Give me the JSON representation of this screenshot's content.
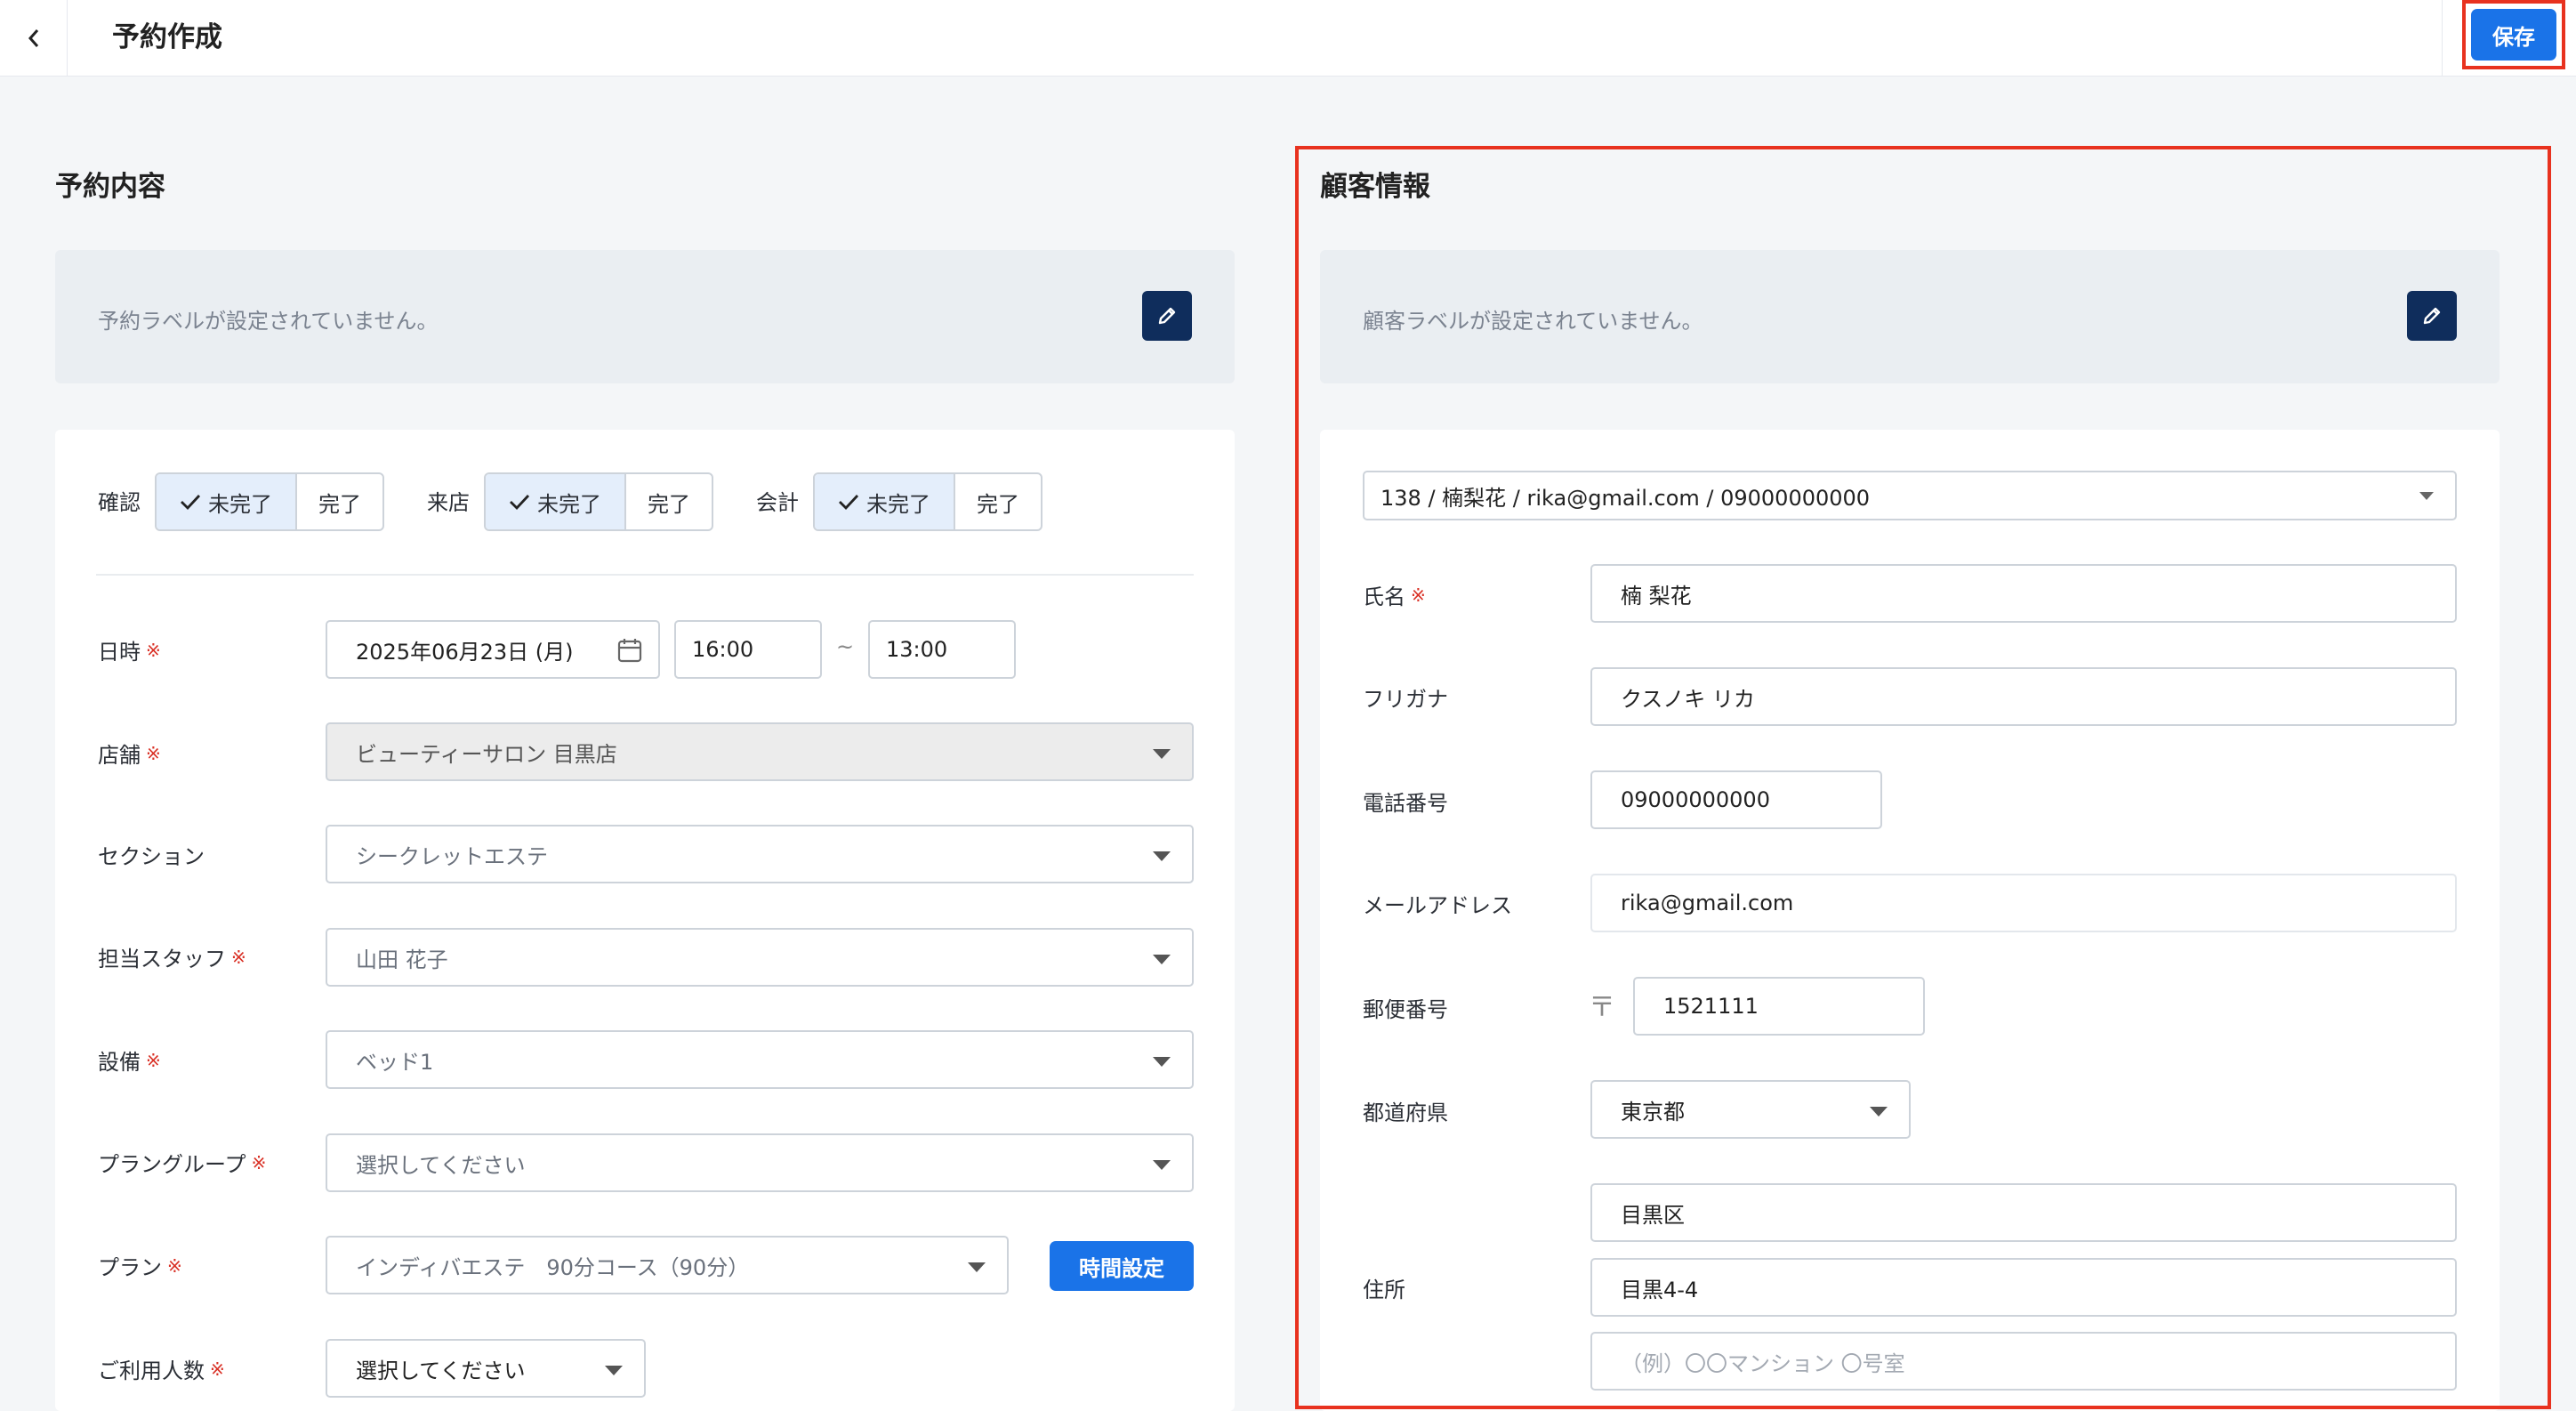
{
  "header": {
    "title": "予約作成",
    "save_label": "保存"
  },
  "reservation": {
    "section_title": "予約内容",
    "label_placeholder": "予約ラベルが設定されていません。",
    "status_groups": [
      {
        "label": "確認",
        "incomplete": "未完了",
        "complete": "完了"
      },
      {
        "label": "来店",
        "incomplete": "未完了",
        "complete": "完了"
      },
      {
        "label": "会計",
        "incomplete": "未完了",
        "complete": "完了"
      }
    ],
    "required_mark": "※",
    "fields": {
      "datetime": {
        "label": "日時",
        "date": "2025年06月23日 (月)",
        "start": "16:00",
        "separator": "~",
        "end": "13:00"
      },
      "store": {
        "label": "店舗",
        "value": "ビューティーサロン 目黒店"
      },
      "section": {
        "label": "セクション",
        "value": "シークレットエステ"
      },
      "staff": {
        "label": "担当スタッフ",
        "value": "山田 花子"
      },
      "equipment": {
        "label": "設備",
        "value": "ベッド1"
      },
      "plan_group": {
        "label": "プラングループ",
        "value": "選択してください"
      },
      "plan": {
        "label": "プラン",
        "value": "インディバエステ　90分コース（90分）",
        "time_button": "時間設定"
      },
      "guests": {
        "label": "ご利用人数",
        "value": "選択してください"
      }
    }
  },
  "customer": {
    "section_title": "顧客情報",
    "label_placeholder": "顧客ラベルが設定されていません。",
    "selector_value": "138 / 楠梨花 / rika@gmail.com / 09000000000",
    "fields": {
      "name": {
        "label": "氏名",
        "value": "楠 梨花"
      },
      "furigana": {
        "label": "フリガナ",
        "value": "クスノキ リカ"
      },
      "phone": {
        "label": "電話番号",
        "value": "09000000000"
      },
      "email": {
        "label": "メールアドレス",
        "value": "rika@gmail.com"
      },
      "postal": {
        "label": "郵便番号",
        "mark": "〒",
        "value": "1521111"
      },
      "prefecture": {
        "label": "都道府県",
        "value": "東京都"
      },
      "address": {
        "label": "住所",
        "line1": "目黒区",
        "line2": "目黒4-4",
        "line3_placeholder": "（例）〇〇マンション 〇号室"
      }
    }
  }
}
